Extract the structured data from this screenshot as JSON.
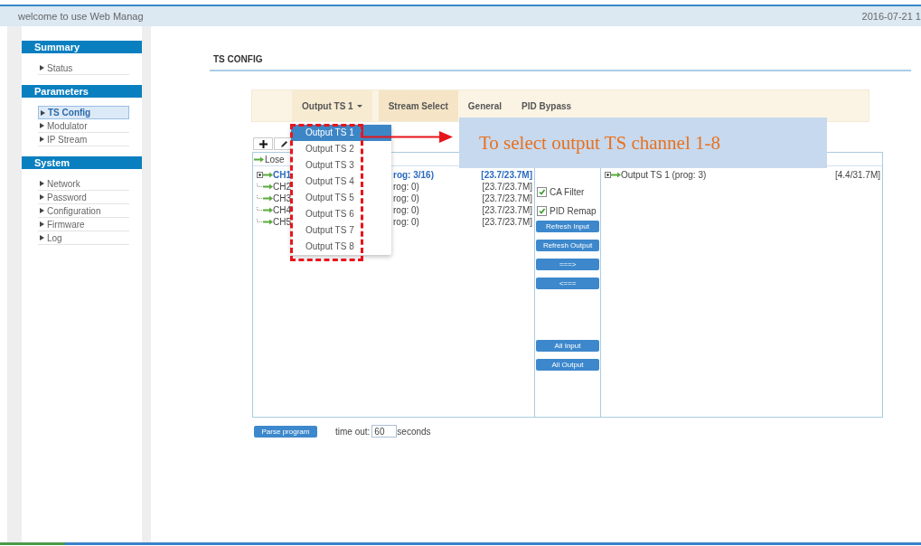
{
  "header": {
    "welcome": "welcome to use Web Manag",
    "date": "2016-07-21 1"
  },
  "sidebar": [
    {
      "title": "Summary",
      "items": [
        {
          "label": "Status",
          "selected": false
        }
      ]
    },
    {
      "title": "Parameters",
      "items": [
        {
          "label": "TS Config",
          "selected": true
        },
        {
          "label": "Modulator",
          "selected": false
        },
        {
          "label": "IP Stream",
          "selected": false
        }
      ]
    },
    {
      "title": "System",
      "items": [
        {
          "label": "Network",
          "selected": false
        },
        {
          "label": "Password",
          "selected": false
        },
        {
          "label": "Configuration",
          "selected": false
        },
        {
          "label": "Firmware",
          "selected": false
        },
        {
          "label": "Log",
          "selected": false
        }
      ]
    }
  ],
  "page_title": "TS CONFIG",
  "tabs": [
    {
      "label": "Output TS 1",
      "kind": "dropdown",
      "expanded": true
    },
    {
      "label": "Stream Select",
      "kind": "tab",
      "selected": true
    },
    {
      "label": "General",
      "kind": "tab",
      "selected": false
    },
    {
      "label": "PID Bypass",
      "kind": "tab",
      "selected": false
    }
  ],
  "dropdown_menu": [
    {
      "label": "Output TS 1",
      "selected": true
    },
    {
      "label": "Output TS 2",
      "selected": false
    },
    {
      "label": "Output TS 3",
      "selected": false
    },
    {
      "label": "Output TS 4",
      "selected": false
    },
    {
      "label": "Output TS 5",
      "selected": false
    },
    {
      "label": "Output TS 6",
      "selected": false
    },
    {
      "label": "Output TS 7",
      "selected": false
    },
    {
      "label": "Output TS 8",
      "selected": false
    }
  ],
  "input_panel": {
    "root": "Lose",
    "channels": [
      {
        "name": "CH1",
        "info": "rog: 3/16)",
        "rate": "[23.7/23.7M]",
        "kind": "branch",
        "selected": true
      },
      {
        "name": "CH2",
        "info": "rog: 0)",
        "rate": "[23.7/23.7M]",
        "kind": "leaf",
        "selected": false
      },
      {
        "name": "CH3",
        "info": "rog: 0)",
        "rate": "[23.7/23.7M]",
        "kind": "leaf",
        "selected": false
      },
      {
        "name": "CH4",
        "info": "rog: 0)",
        "rate": "[23.7/23.7M]",
        "kind": "leaf",
        "selected": false
      },
      {
        "name": "CH5",
        "info": "rog: 0)",
        "rate": "[23.7/23.7M]",
        "kind": "leaf",
        "selected": false
      }
    ]
  },
  "options": [
    {
      "label": "CA Filter",
      "checked": true
    },
    {
      "label": "PID Remap",
      "checked": true
    }
  ],
  "actions": [
    [
      "Refresh Input",
      "Refresh Output",
      "===>",
      "<==="
    ],
    [
      "All Input",
      "All Output"
    ]
  ],
  "output_panel": {
    "items": [
      {
        "name": "Output TS 1 (prog: 3)",
        "rate": "[4.4/31.7M]",
        "kind": "branch"
      }
    ]
  },
  "parse": {
    "button": "Parse program",
    "timeout_label": "time out:",
    "timeout_value": "60",
    "unit": "seconds"
  },
  "annotation": {
    "text": "To select output TS channel 1-8"
  }
}
